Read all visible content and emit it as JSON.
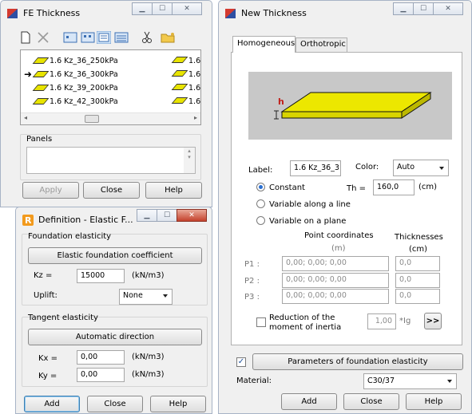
{
  "fe_thickness": {
    "title": "FE Thickness",
    "icons": [
      "new-icon",
      "delete-icon",
      "small-icons-icon",
      "list-icon",
      "large-icons-icon",
      "details-icon",
      "cut-icon",
      "folder-icon"
    ],
    "list": [
      {
        "label": "1.6 Kz_36_250kPa",
        "label2": "1.6",
        "current": false
      },
      {
        "label": "1.6 Kz_36_300kPa",
        "label2": "1.6",
        "current": true
      },
      {
        "label": "1.6 Kz_39_200kPa",
        "label2": "1.6",
        "current": false
      },
      {
        "label": "1.6 Kz_42_300kPa",
        "label2": "1.6",
        "current": false
      }
    ],
    "panels_label": "Panels",
    "buttons": {
      "apply": "Apply",
      "close": "Close",
      "help": "Help"
    }
  },
  "definition": {
    "title": "Definition - Elastic F...",
    "foundation_header": "Foundation elasticity",
    "foundation_button": "Elastic foundation coefficient",
    "kz_label": "Kz =",
    "kz_value": "15000",
    "kz_unit": "(kN/m3)",
    "uplift_label": "Uplift:",
    "uplift_value": "None",
    "tangent_header": "Tangent elasticity",
    "tangent_button": "Automatic direction",
    "kx_label": "Kx =",
    "kx_value": "0,00",
    "kx_unit": "(kN/m3)",
    "ky_label": "Ky =",
    "ky_value": "0,00",
    "ky_unit": "(kN/m3)",
    "buttons": {
      "add": "Add",
      "close": "Close",
      "help": "Help"
    }
  },
  "new_thickness": {
    "title": "New Thickness",
    "tabs": [
      "Homogeneous",
      "Orthotropic"
    ],
    "active_tab": "Homogeneous",
    "preview_h_label": "h",
    "label_label": "Label:",
    "label_value": "1.6 Kz_36_3",
    "color_label": "Color:",
    "color_value": "Auto",
    "options": [
      {
        "label": "Constant",
        "selected": true
      },
      {
        "label": "Variable along a line",
        "selected": false
      },
      {
        "label": "Variable on a plane",
        "selected": false
      }
    ],
    "th_label": "Th =",
    "th_value": "160,0",
    "th_unit": "(cm)",
    "point_coords_header": "Point coordinates",
    "point_coords_unit": "(m)",
    "thicknesses_header": "Thicknesses",
    "thicknesses_unit": "(cm)",
    "points": [
      {
        "label": "P1 :",
        "coords": "0,00; 0,00; 0,00",
        "thickness": "0,0"
      },
      {
        "label": "P2 :",
        "coords": "0,00; 0,00; 0,00",
        "thickness": "0,0"
      },
      {
        "label": "P3 :",
        "coords": "0,00; 0,00; 0,00",
        "thickness": "0,0"
      }
    ],
    "reduction_label_1": "Reduction of the",
    "reduction_label_2": "moment of inertia",
    "reduction_value": "1,00",
    "reduction_unit": "*Ig",
    "more_button": ">>",
    "foundation_checked": true,
    "foundation_button": "Parameters of foundation elasticity",
    "material_label": "Material:",
    "material_value": "C30/37",
    "buttons": {
      "add": "Add",
      "close": "Close",
      "help": "Help"
    }
  },
  "colors": {
    "accent": "#2a6fd1",
    "plate": "#e8e400",
    "preview_bg": "#c8c8c8"
  }
}
